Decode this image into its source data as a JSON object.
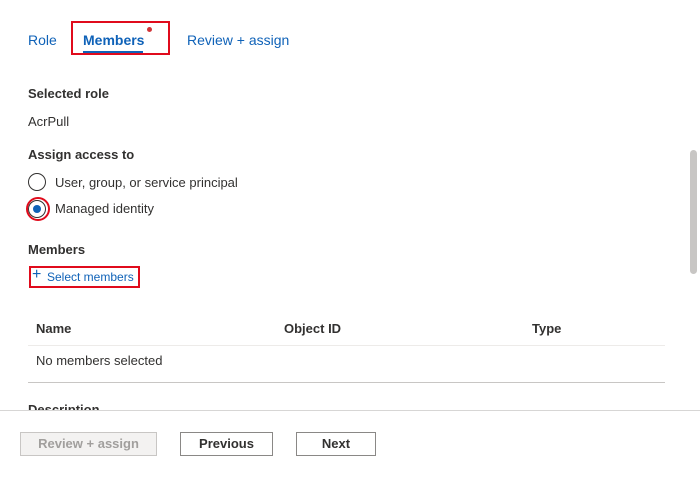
{
  "tabs": {
    "role": "Role",
    "members": "Members",
    "review": "Review + assign"
  },
  "selected_role": {
    "label": "Selected role",
    "value": "AcrPull"
  },
  "assign_access": {
    "label": "Assign access to",
    "options": [
      {
        "label": "User, group, or service principal",
        "selected": false
      },
      {
        "label": "Managed identity",
        "selected": true
      }
    ]
  },
  "members": {
    "label": "Members",
    "select_link": "Select members",
    "plus_glyph": "+",
    "table": {
      "columns": [
        "Name",
        "Object ID",
        "Type"
      ],
      "empty_text": "No members selected"
    }
  },
  "description": {
    "label": "Description"
  },
  "footer": {
    "review_label": "Review + assign",
    "previous_label": "Previous",
    "next_label": "Next"
  },
  "colors": {
    "accent": "#0f62b8",
    "highlight": "#e00b1c",
    "required_dot": "#d13438"
  }
}
